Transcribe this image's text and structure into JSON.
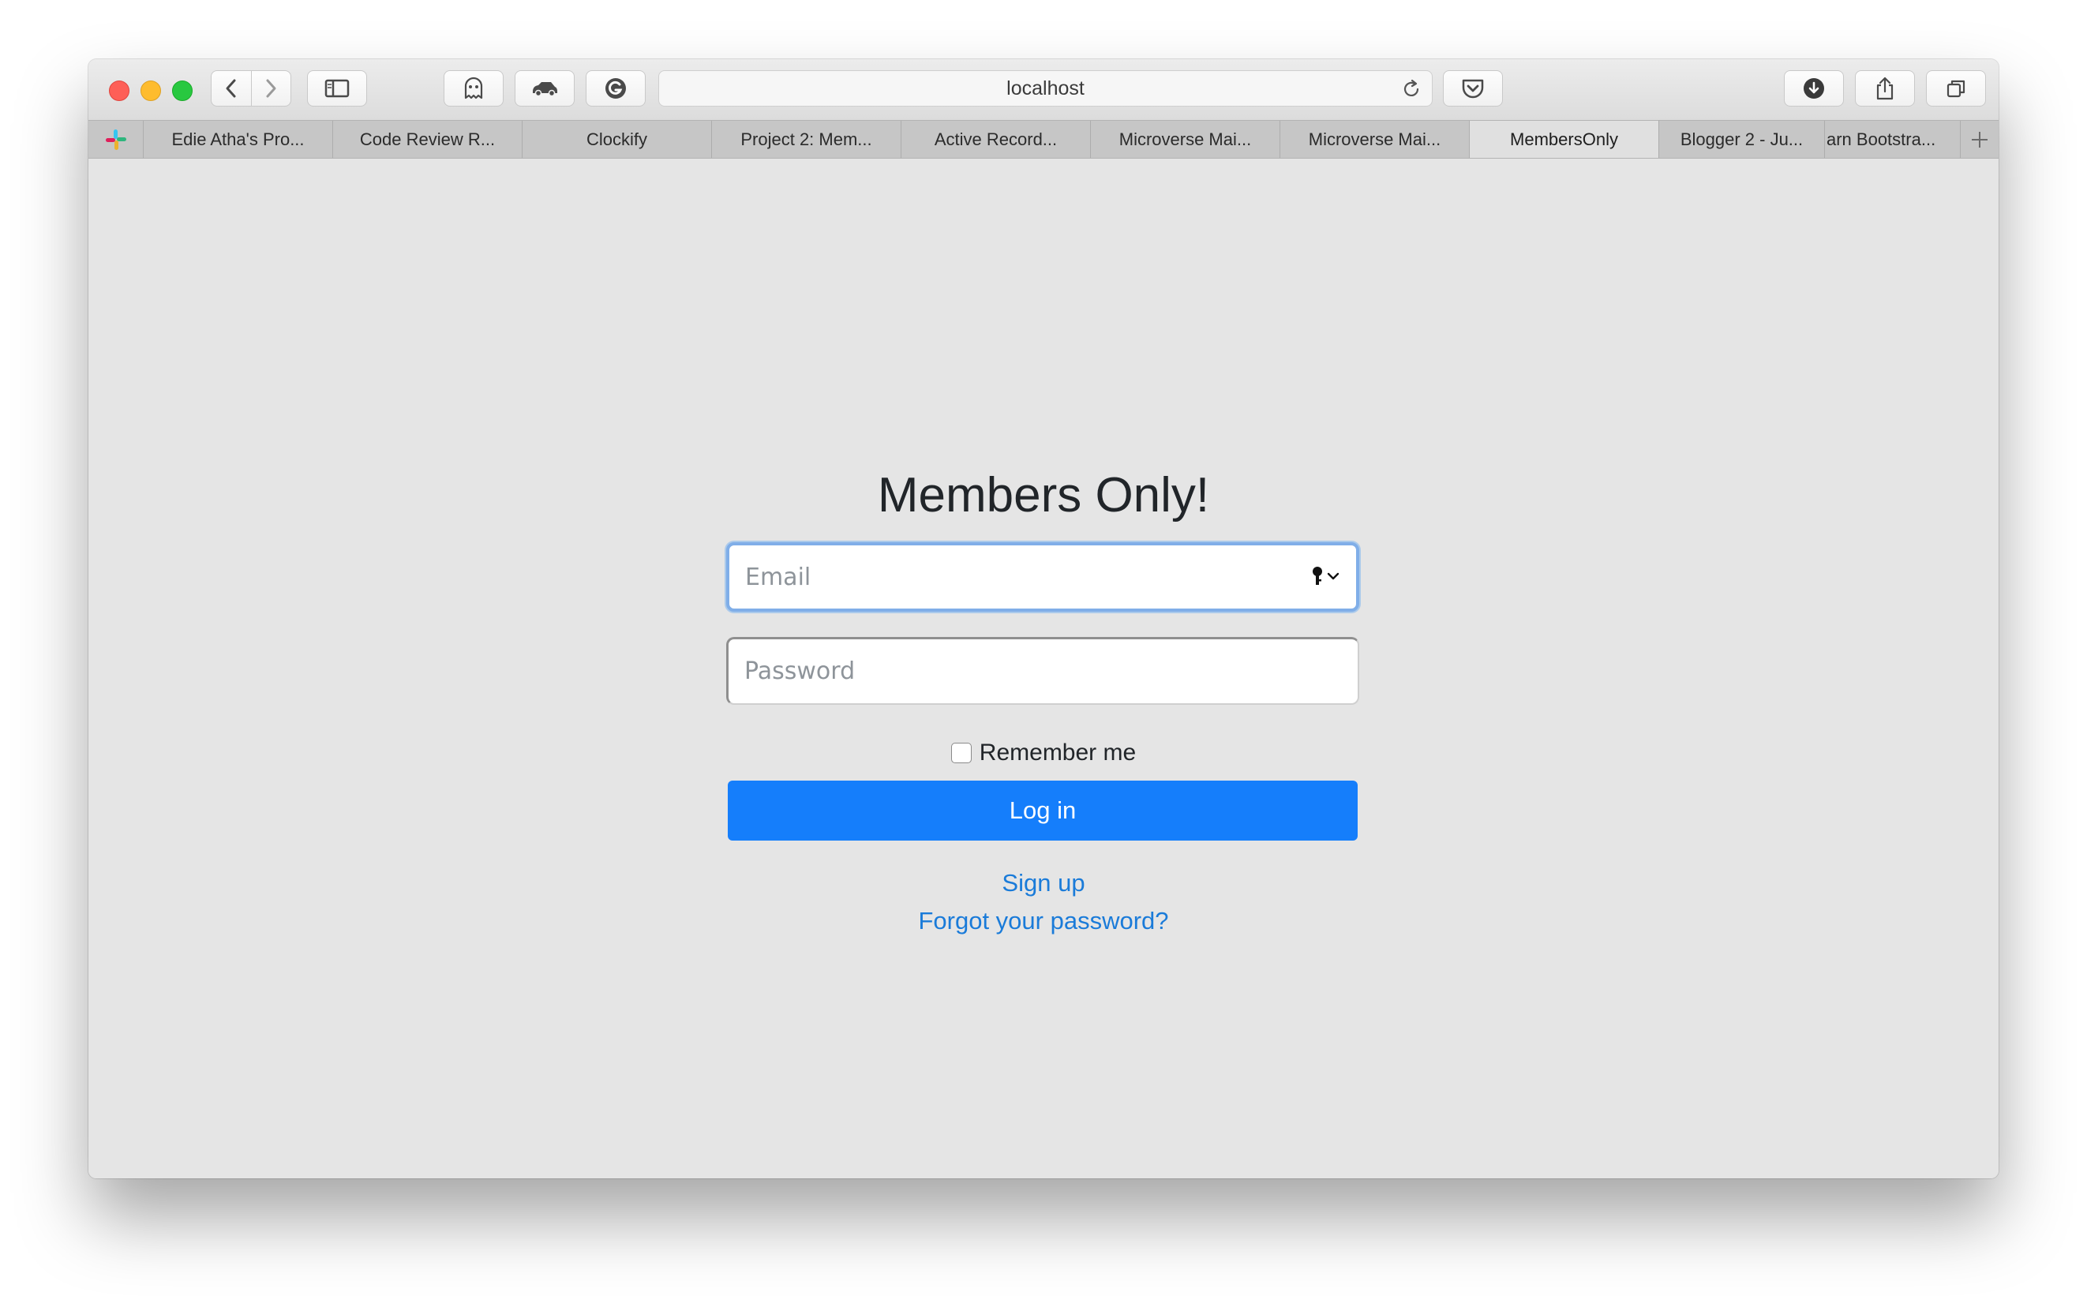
{
  "browser": {
    "address": "localhost",
    "tabs": [
      {
        "label": "Edie Atha's Pro..."
      },
      {
        "label": "Code Review R..."
      },
      {
        "label": "Clockify"
      },
      {
        "label": "Project 2: Mem..."
      },
      {
        "label": "Active Record..."
      },
      {
        "label": "Microverse Mai..."
      },
      {
        "label": "Microverse Mai..."
      },
      {
        "label": "MembersOnly"
      },
      {
        "label": "Blogger 2 - Ju..."
      },
      {
        "label": "arn Bootstra..."
      }
    ],
    "active_tab_index": 7,
    "icons": {
      "back": "chevron-left-icon",
      "forward": "chevron-right-icon",
      "sidebar": "sidebar-icon",
      "ghostery": "ghost-icon",
      "extension_car": "car-icon",
      "grammarly": "grammarly-icon",
      "reload": "reload-icon",
      "pocket": "pocket-icon",
      "download": "download-icon",
      "share": "share-icon",
      "tab_overview": "tabs-overview-icon",
      "pinned": "slack-icon",
      "new_tab": "plus-icon"
    }
  },
  "page": {
    "title": "Members Only!",
    "email": {
      "value": "",
      "placeholder": "Email"
    },
    "password": {
      "value": "",
      "placeholder": "Password"
    },
    "remember_label": "Remember me",
    "remember_checked": false,
    "login_label": "Log in",
    "signup_label": "Sign up",
    "forgot_label": "Forgot your password?"
  },
  "colors": {
    "primary": "#157efb",
    "link": "#1a7bd9",
    "background": "#e5e5e5",
    "focus_ring": "#80aee8"
  }
}
